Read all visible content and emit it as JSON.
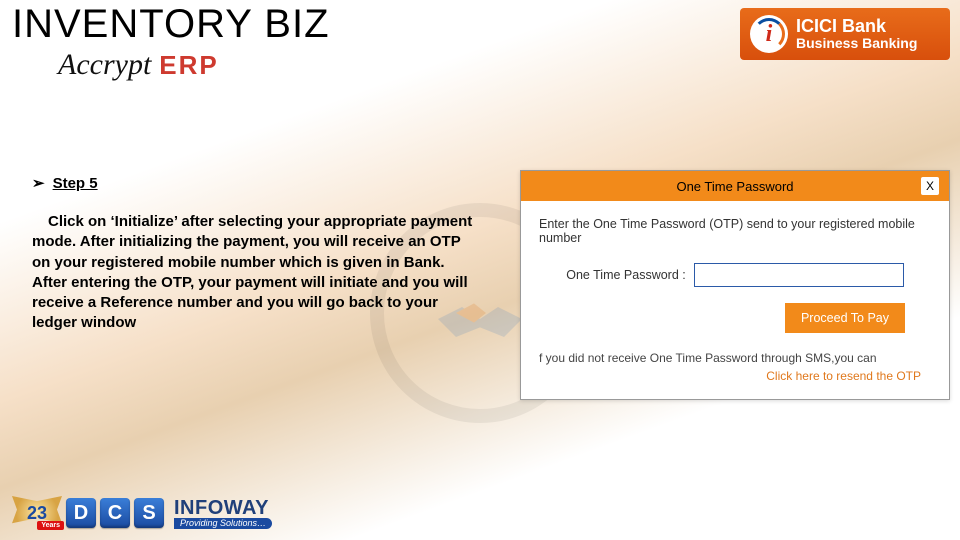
{
  "slide": {
    "title": "INVENTORY BIZ",
    "brand_primary": "Accrypt",
    "brand_suffix": "ERP"
  },
  "bank": {
    "line1": "ICICI Bank",
    "line2": "Business Banking",
    "badge_letter": "i"
  },
  "step": {
    "label": "Step 5",
    "body": "Click on ‘Initialize’ after selecting your appropriate payment mode. After initializing the payment, you will receive an OTP on your registered mobile number which is given in Bank. After entering the OTP, your payment will initiate and you will receive a Reference number and you will go back to your ledger window"
  },
  "otp": {
    "title": "One Time Password",
    "close": "X",
    "prompt": "Enter the One Time Password (OTP) send to your registered mobile number",
    "field_label": "One Time Password :",
    "input_value": "",
    "proceed": "Proceed To Pay",
    "resend_pre": "f you did not receive One Time Password through SMS,you can",
    "resend_link": "Click here to resend the OTP"
  },
  "footer": {
    "years_num": "23",
    "years_label": "Years",
    "d": "D",
    "c": "C",
    "s": "S",
    "infoway": "INFOWAY",
    "tagline": "Providing Solutions…"
  },
  "colors": {
    "accent_orange": "#f28a1a",
    "brand_red": "#ce3a2f",
    "brand_blue": "#1a4aa0"
  }
}
